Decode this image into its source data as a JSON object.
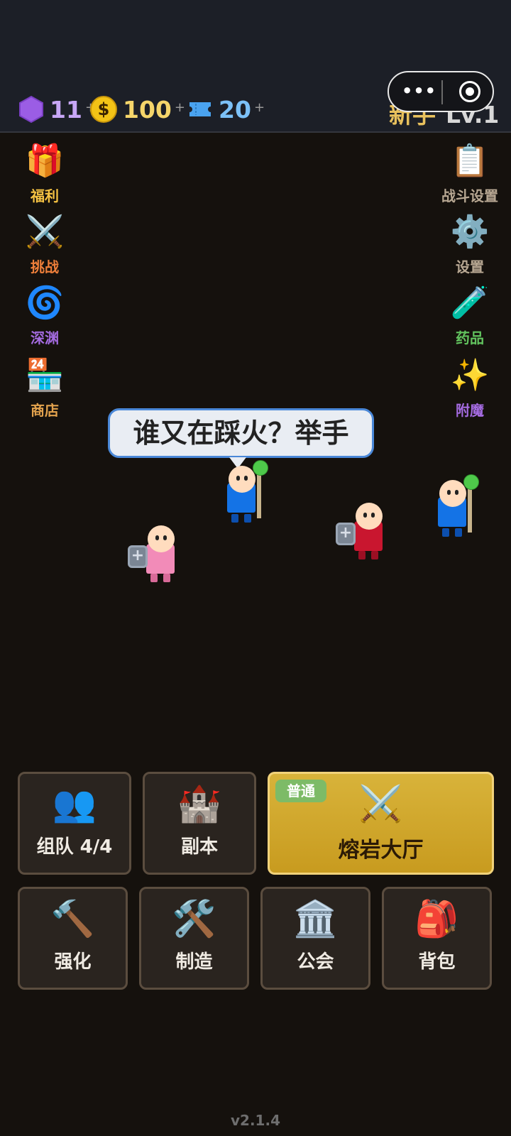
{
  "topbar": {
    "gems": "11",
    "coins": "100",
    "coin_symbol": "$",
    "tickets": "20",
    "plus": "+",
    "rank_title": "新手",
    "rank_level": "Lv.1",
    "capsule_dots": "•••"
  },
  "left_menu": [
    {
      "label": "福利",
      "icon": "gift-icon",
      "glyph": "🎁",
      "color": "#f6c343"
    },
    {
      "label": "挑战",
      "icon": "crossed-swords-icon",
      "glyph": "⚔️",
      "color": "#ee7f3a"
    },
    {
      "label": "深渊",
      "icon": "cyclone-icon",
      "glyph": "🌀",
      "color": "#a46be0"
    },
    {
      "label": "商店",
      "icon": "convenience-store-icon",
      "glyph": "🏪",
      "color": "#e2a24d"
    }
  ],
  "right_menu": [
    {
      "label": "战斗设置",
      "icon": "clipboard-icon",
      "glyph": "📋",
      "color": "#b8a893"
    },
    {
      "label": "设置",
      "icon": "gear-icon",
      "glyph": "⚙️",
      "color": "#b8a893"
    },
    {
      "label": "药品",
      "icon": "test-tube-icon",
      "glyph": "🧪",
      "color": "#62c35e"
    },
    {
      "label": "附魔",
      "icon": "sparkles-icon",
      "glyph": "✨",
      "color": "#a46be0"
    }
  ],
  "chat_bubble": "谁又在踩火？举手",
  "shield_mark": "+",
  "colors": {
    "mage_robe": "#1473e6",
    "pink_body": "#f28bb8",
    "red_body": "#c9162f",
    "gold_button": "#d2a62b",
    "tag_green": "#7dbb67"
  },
  "actions_row1": [
    {
      "label": "组队 4/4",
      "icon": "busts-icon",
      "glyph": "👥"
    },
    {
      "label": "副本",
      "icon": "castle-icon",
      "glyph": "🏰"
    }
  ],
  "main_action": {
    "tag": "普通",
    "label": "熔岩大厅",
    "icon": "crossed-swords-icon",
    "glyph": "⚔️"
  },
  "actions_row2": [
    {
      "label": "强化",
      "icon": "hammer-icon",
      "glyph": "🔨"
    },
    {
      "label": "制造",
      "icon": "hammer-wrench-icon",
      "glyph": "🛠️"
    },
    {
      "label": "公会",
      "icon": "classical-building-icon",
      "glyph": "🏛️"
    },
    {
      "label": "背包",
      "icon": "backpack-icon",
      "glyph": "🎒"
    }
  ],
  "version": "v2.1.4"
}
